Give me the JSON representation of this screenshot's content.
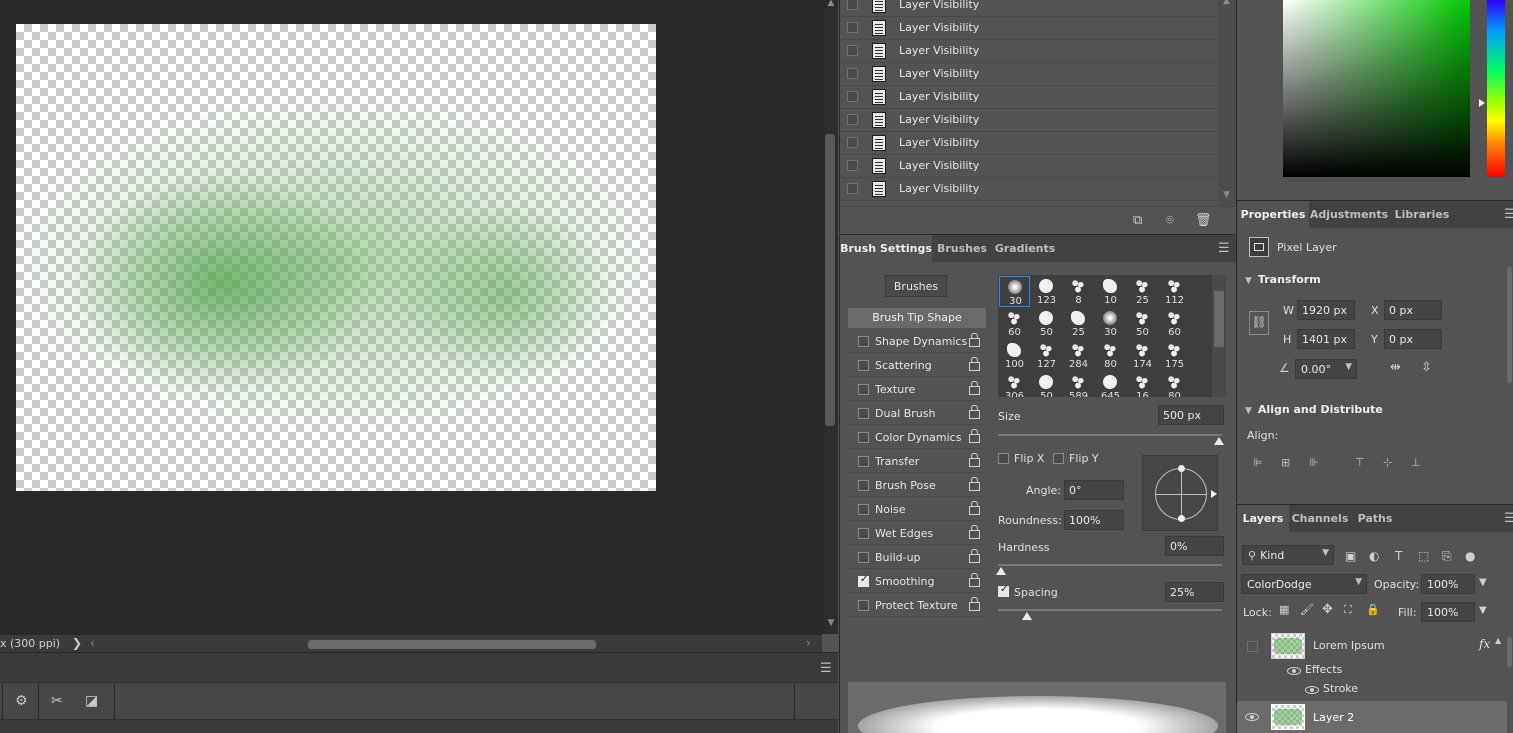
{
  "status_bar": {
    "doc_info": "x (300 ppi)",
    "chevron": "❯"
  },
  "history": {
    "items": [
      {
        "label": "Layer Visibility"
      },
      {
        "label": "Layer Visibility"
      },
      {
        "label": "Layer Visibility"
      },
      {
        "label": "Layer Visibility"
      },
      {
        "label": "Layer Visibility"
      },
      {
        "label": "Layer Visibility"
      },
      {
        "label": "Layer Visibility"
      },
      {
        "label": "Layer Visibility"
      },
      {
        "label": "Layer Visibility"
      }
    ]
  },
  "brush_panel": {
    "tabs": [
      "Brush Settings",
      "Brushes",
      "Gradients"
    ],
    "brushes_button": "Brushes",
    "tip_shape_label": "Brush Tip Shape",
    "options": [
      {
        "label": "Shape Dynamics",
        "checked": false
      },
      {
        "label": "Scattering",
        "checked": false
      },
      {
        "label": "Texture",
        "checked": false
      },
      {
        "label": "Dual Brush",
        "checked": false
      },
      {
        "label": "Color Dynamics",
        "checked": false
      },
      {
        "label": "Transfer",
        "checked": false
      },
      {
        "label": "Brush Pose",
        "checked": false
      },
      {
        "label": "Noise",
        "checked": false
      },
      {
        "label": "Wet Edges",
        "checked": false
      },
      {
        "label": "Build-up",
        "checked": false
      },
      {
        "label": "Smoothing",
        "checked": true
      },
      {
        "label": "Protect Texture",
        "checked": false
      }
    ],
    "brush_sizes": [
      "30",
      "123",
      "8",
      "10",
      "25",
      "112",
      "60",
      "50",
      "25",
      "30",
      "50",
      "60",
      "100",
      "127",
      "284",
      "80",
      "174",
      "175",
      "306",
      "50",
      "589",
      "645",
      "16",
      "80"
    ],
    "size_label": "Size",
    "size_value": "500 px",
    "size_fraction": 1.0,
    "flip_x_label": "Flip X",
    "flip_y_label": "Flip Y",
    "angle_label": "Angle:",
    "angle_value": "0°",
    "roundness_label": "Roundness:",
    "roundness_value": "100%",
    "hardness_label": "Hardness",
    "hardness_value": "0%",
    "hardness_fraction": 0.0,
    "spacing_label": "Spacing",
    "spacing_checked": true,
    "spacing_value": "25%",
    "spacing_fraction": 0.12
  },
  "properties": {
    "tabs": [
      "Properties",
      "Adjustments",
      "Libraries"
    ],
    "layer_type": "Pixel Layer",
    "transform_title": "Transform",
    "w_label": "W",
    "w_value": "1920 px",
    "x_label": "X",
    "x_value": "0 px",
    "h_label": "H",
    "h_value": "1401 px",
    "y_label": "Y",
    "y_value": "0 px",
    "rotation_value": "0.00°",
    "align_title": "Align and Distribute",
    "align_label": "Align:"
  },
  "layers": {
    "tabs": [
      "Layers",
      "Channels",
      "Paths"
    ],
    "filter_kind": "Kind",
    "blend_mode": "ColorDodge",
    "opacity_label": "Opacity:",
    "opacity_value": "100%",
    "lock_label": "Lock:",
    "fill_label": "Fill:",
    "fill_value": "100%",
    "items": [
      {
        "name": "Lorem Ipsum",
        "fx": "fx",
        "effects_label": "Effects",
        "stroke_label": "Stroke"
      },
      {
        "name": "Layer 2"
      }
    ]
  },
  "colors": {
    "accent_selected": "#1e8cff",
    "panel_bg": "#535353",
    "canvas_bg": "#282828",
    "picker_hue": "#00c800"
  }
}
